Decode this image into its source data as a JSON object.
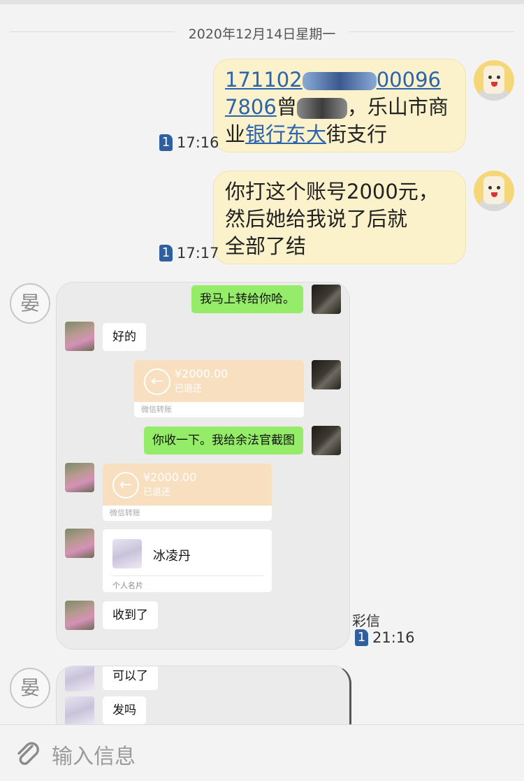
{
  "date_separator": "2020年12月14日星期一",
  "messages": [
    {
      "segments": {
        "l1a": "171102",
        "l1b": "00096",
        "l2a": "7806",
        "l2b": "曾",
        "l2c": "，乐山市商",
        "l3a": "业",
        "l3b": "银行东大",
        "l3c": "街支行"
      },
      "sim": "1",
      "time": "17:16"
    },
    {
      "lines": [
        "你打这个账号2000元，",
        "然后她给我说了后就",
        "全部了结"
      ],
      "sim": "1",
      "time": "17:17"
    }
  ],
  "contact_initial": "晏",
  "mms": {
    "chat": {
      "msg1": "我马上转给你哈。",
      "msg2": "好的",
      "transfer1": {
        "amount": "¥2000.00",
        "status": "已退还",
        "footer": "微信转账"
      },
      "msg3": "你收一下。我给余法官截图",
      "transfer2": {
        "amount": "¥2000.00",
        "status": "已退还",
        "footer": "微信转账"
      },
      "card": {
        "name": "冰凌丹",
        "footer": "个人名片"
      },
      "msg4": "收到了"
    },
    "label": "彩信",
    "sim": "1",
    "time": "21:16"
  },
  "mms2": {
    "msg1": "可以了",
    "msg2": "发吗"
  },
  "input": {
    "placeholder": "输入信息"
  }
}
